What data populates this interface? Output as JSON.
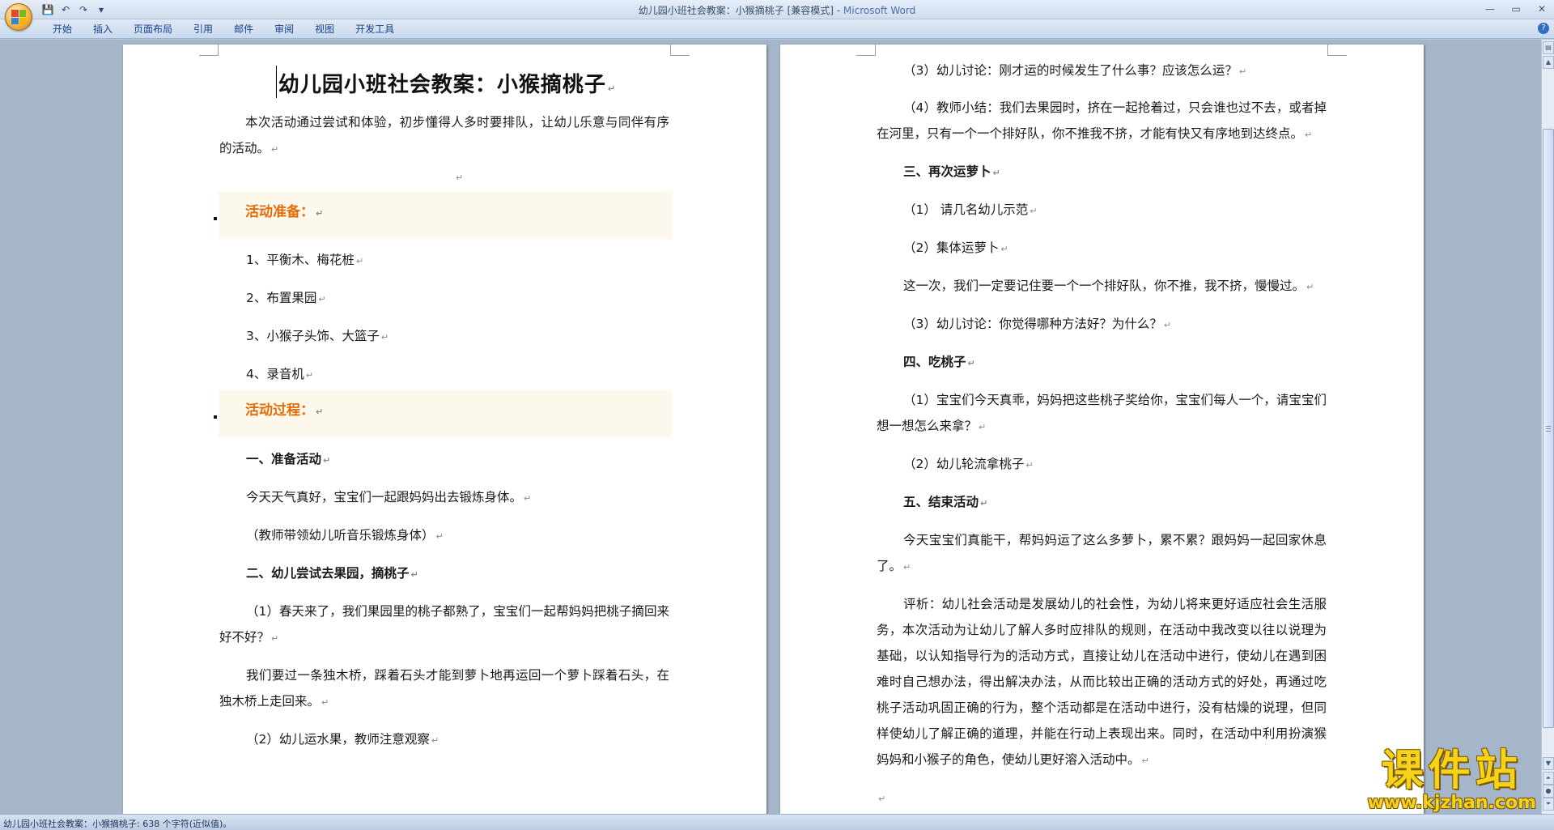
{
  "window": {
    "title_prefix": "幼儿园小班社会教案：小猴摘桃子 [兼容模式] - ",
    "app_name": "Microsoft Word",
    "minimize": "—",
    "restore": "▭",
    "close": "✕"
  },
  "quick_access": {
    "save": "💾",
    "undo": "↶",
    "redo": "↷",
    "more": "▾"
  },
  "ribbon": {
    "tabs": [
      "开始",
      "插入",
      "页面布局",
      "引用",
      "邮件",
      "审阅",
      "视图",
      "开发工具"
    ],
    "help": "?"
  },
  "colors": {
    "accent_heading": "#e36c09",
    "shade_bg": "#fcf8ec",
    "title_app": "#4b6fb0"
  },
  "para_mark": "↵",
  "page1": {
    "title": "幼儿园小班社会教案：小猴摘桃子",
    "intro": "本次活动通过尝试和体验，初步懂得人多时要排队，让幼儿乐意与同伴有序的活动。",
    "prep_heading": "活动准备：",
    "prep_items": [
      "1、平衡木、梅花桩",
      "2、布置果园",
      "3、小猴子头饰、大篮子",
      "4、录音机"
    ],
    "process_heading": "活动过程：",
    "s1_heading": "一、准备活动",
    "s1_p1": "今天天气真好，宝宝们一起跟妈妈出去锻炼身体。",
    "s1_p2": "（教师带领幼儿听音乐锻炼身体）",
    "s2_heading": "二、幼儿尝试去果园，摘桃子",
    "s2_p1": "（1）春天来了，我们果园里的桃子都熟了，宝宝们一起帮妈妈把桃子摘回来好不好？",
    "s2_p2": "我们要过一条独木桥，踩着石头才能到萝卜地再运回一个萝卜踩着石头，在独木桥上走回来。",
    "s2_p3": "（2）幼儿运水果，教师注意观察"
  },
  "page2": {
    "p1": "（3）幼儿讨论：刚才运的时候发生了什么事？应该怎么运？",
    "p2": "（4）教师小结：我们去果园时，挤在一起抢着过，只会谁也过不去，或者掉在河里，只有一个一个排好队，你不推我不挤，才能有快又有序地到达终点。",
    "s3_heading": "三、再次运萝卜",
    "s3_p1": "（1） 请几名幼儿示范",
    "s3_p2": "（2）集体运萝卜",
    "s3_p3": "这一次，我们一定要记住要一个一个排好队，你不推，我不挤，慢慢过。",
    "s3_p4": "（3）幼儿讨论：你觉得哪种方法好？为什么？",
    "s4_heading": "四、吃桃子",
    "s4_p1": "（1）宝宝们今天真乖，妈妈把这些桃子奖给你，宝宝们每人一个，请宝宝们想一想怎么来拿？",
    "s4_p2": "（2）幼儿轮流拿桃子",
    "s5_heading": "五、结束活动",
    "s5_p1": "今天宝宝们真能干，帮妈妈运了这么多萝卜，累不累？跟妈妈一起回家休息了。",
    "review": "评析：幼儿社会活动是发展幼儿的社会性，为幼儿将来更好适应社会生活服务，本次活动为让幼儿了解人多时应排队的规则，在活动中我改变以往以说理为基础，以认知指导行为的活动方式，直接让幼儿在活动中进行，使幼儿在遇到困难时自己想办法，得出解决办法，从而比较出正确的活动方式的好处，再通过吃桃子活动巩固正确的行为，整个活动都是在活动中进行，没有枯燥的说理，但同样使幼儿了解正确的道理，并能在行动上表现出来。同时，在活动中利用扮演猴妈妈和小猴子的角色，使幼儿更好溶入活动中。"
  },
  "status": {
    "text": "幼儿园小班社会教案：小猴摘桃子: 638 个字符(近似值)。"
  },
  "watermark": {
    "title": "课件站",
    "url": "www.kjzhan.com"
  }
}
